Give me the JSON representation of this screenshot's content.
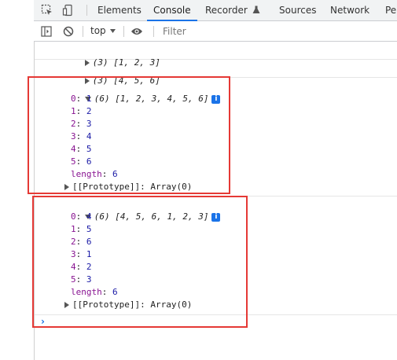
{
  "tabs": [
    "Elements",
    "Console",
    "Recorder",
    "Sources",
    "Network",
    "Per"
  ],
  "active_tab": "Console",
  "toolbar": {
    "context": "top",
    "filter_placeholder": "Filter"
  },
  "icons": {
    "inspect": "inspect-element-icon",
    "device": "device-toggle-icon",
    "recorder": "flask-icon",
    "sidebar": "sidebar-toggle-icon",
    "clear": "clear-console-icon",
    "eye": "eye-icon",
    "info": "info-badge-icon"
  },
  "colors": {
    "accent": "#1a73e8",
    "highlight": "#e53935",
    "key": "#881391",
    "number": "#1a1aa6"
  },
  "console": {
    "log1": "(3) [1, 2, 3]",
    "log2": "(3) [4, 5, 6]",
    "log3": {
      "preview": "(6) [1, 2, 3, 4, 5, 6]",
      "entries": [
        {
          "key": "0",
          "value": "1"
        },
        {
          "key": "1",
          "value": "2"
        },
        {
          "key": "2",
          "value": "3"
        },
        {
          "key": "3",
          "value": "4"
        },
        {
          "key": "4",
          "value": "5"
        },
        {
          "key": "5",
          "value": "6"
        }
      ],
      "length_key": "length",
      "length_value": "6",
      "proto_key": "[[Prototype]]",
      "proto_value": "Array(0)"
    },
    "log4": {
      "preview": "(6) [4, 5, 6, 1, 2, 3]",
      "entries": [
        {
          "key": "0",
          "value": "4"
        },
        {
          "key": "1",
          "value": "5"
        },
        {
          "key": "2",
          "value": "6"
        },
        {
          "key": "3",
          "value": "1"
        },
        {
          "key": "4",
          "value": "2"
        },
        {
          "key": "5",
          "value": "3"
        }
      ],
      "length_key": "length",
      "length_value": "6",
      "proto_key": "[[Prototype]]",
      "proto_value": "Array(0)"
    },
    "info_glyph": "i",
    "prompt": "›"
  }
}
